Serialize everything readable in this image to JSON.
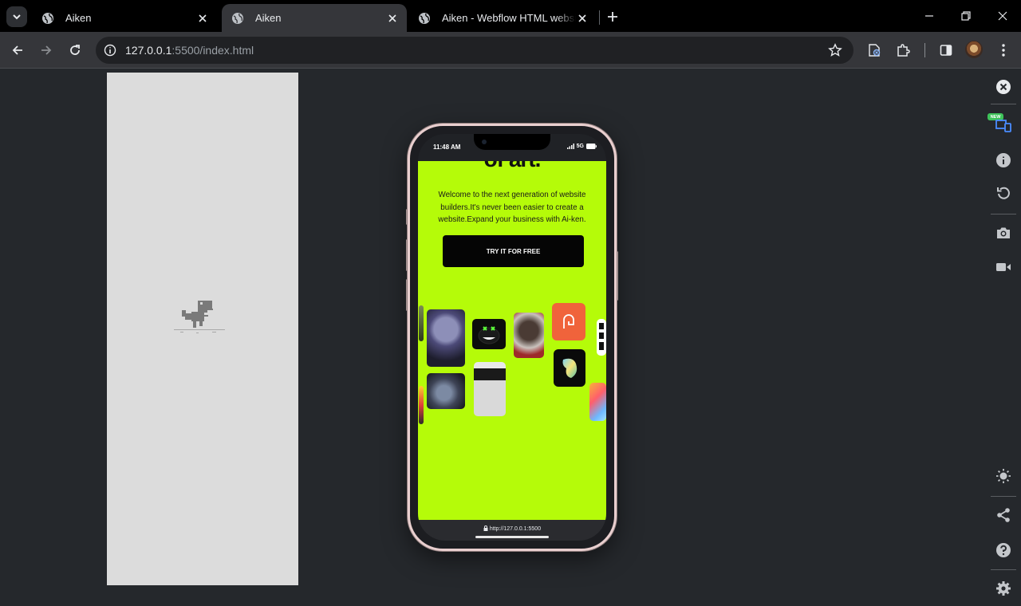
{
  "tabs": [
    {
      "title": "Aiken",
      "active": false
    },
    {
      "title": "Aiken",
      "active": true
    },
    {
      "title": "Aiken - Webflow HTML website",
      "active": false
    }
  ],
  "address": {
    "host": "127.0.0.1",
    "path": ":5500/index.html"
  },
  "phone": {
    "status_time": "11:48 AM",
    "status_network": "5G",
    "headline_partial": "of art.",
    "description": "Welcome to the next generation of website builders.It's never been easier to create a website.Expand your business with Ai-ken.",
    "cta_label": "TRY IT FOR FREE",
    "bottom_url": "http://127.0.0.1:5500"
  },
  "rail": {
    "new_badge": "NEW"
  },
  "colors": {
    "accent_green": "#b5fb09",
    "page_bg": "#25282c"
  }
}
